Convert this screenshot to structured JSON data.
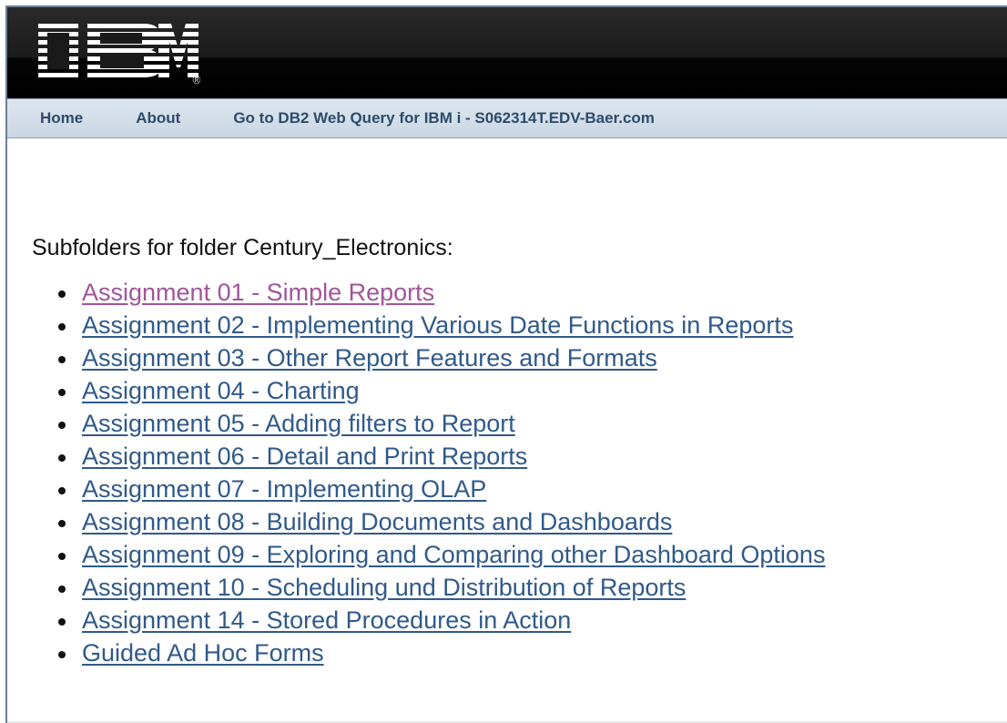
{
  "banner": {
    "logo_text": "IBM",
    "registered_mark": "®"
  },
  "nav": {
    "items": [
      {
        "label": "Home"
      },
      {
        "label": "About"
      },
      {
        "label": "Go to DB2 Web Query for IBM i - S062314T.EDV-Baer.com"
      }
    ]
  },
  "main": {
    "heading": "Subfolders for folder Century_Electronics:",
    "folders": [
      {
        "label": "Assignment 01 - Simple Reports",
        "visited": true
      },
      {
        "label": "Assignment 02 - Implementing Various Date Functions in Reports",
        "visited": false
      },
      {
        "label": "Assignment 03 - Other Report Features and Formats",
        "visited": false
      },
      {
        "label": "Assignment 04 - Charting",
        "visited": false
      },
      {
        "label": "Assignment 05 - Adding filters to Report",
        "visited": false
      },
      {
        "label": "Assignment 06 - Detail and Print Reports",
        "visited": false
      },
      {
        "label": "Assignment 07 - Implementing OLAP",
        "visited": false
      },
      {
        "label": "Assignment 08 - Building Documents and Dashboards",
        "visited": false
      },
      {
        "label": "Assignment 09 - Exploring and Comparing other Dashboard Options",
        "visited": false
      },
      {
        "label": "Assignment 10 - Scheduling und Distribution of Reports",
        "visited": false
      },
      {
        "label": "Assignment 14 - Stored Procedures in Action",
        "visited": false
      },
      {
        "label": "Guided Ad Hoc Forms",
        "visited": false
      }
    ]
  },
  "colors": {
    "link": "#2f5a8a",
    "visited_link": "#a0559a",
    "nav_text": "#2e4a6a",
    "banner": "#000000"
  }
}
